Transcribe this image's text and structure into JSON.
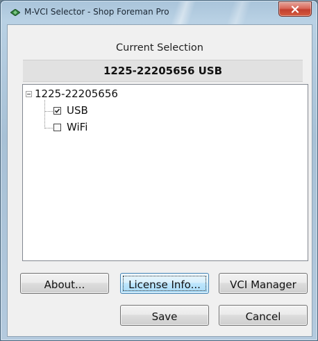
{
  "window": {
    "title": "M-VCI Selector - Shop Foreman Pro",
    "icon": "diamond-app-icon",
    "close_icon": "close-icon",
    "colors": {
      "frame": "#b4cade",
      "close_button": "#c2402f",
      "client_background": "#f0f0f0"
    }
  },
  "current_selection": {
    "label": "Current Selection",
    "value": "1225-22205656 USB"
  },
  "tree": {
    "root": {
      "label": "1225-22205656",
      "expanded": true,
      "children": [
        {
          "label": "USB",
          "checked": true
        },
        {
          "label": "WiFi",
          "checked": false
        }
      ]
    }
  },
  "buttons": {
    "about": "About...",
    "license_info": "License Info...",
    "vci_manager": "VCI Manager",
    "save": "Save",
    "cancel": "Cancel"
  }
}
